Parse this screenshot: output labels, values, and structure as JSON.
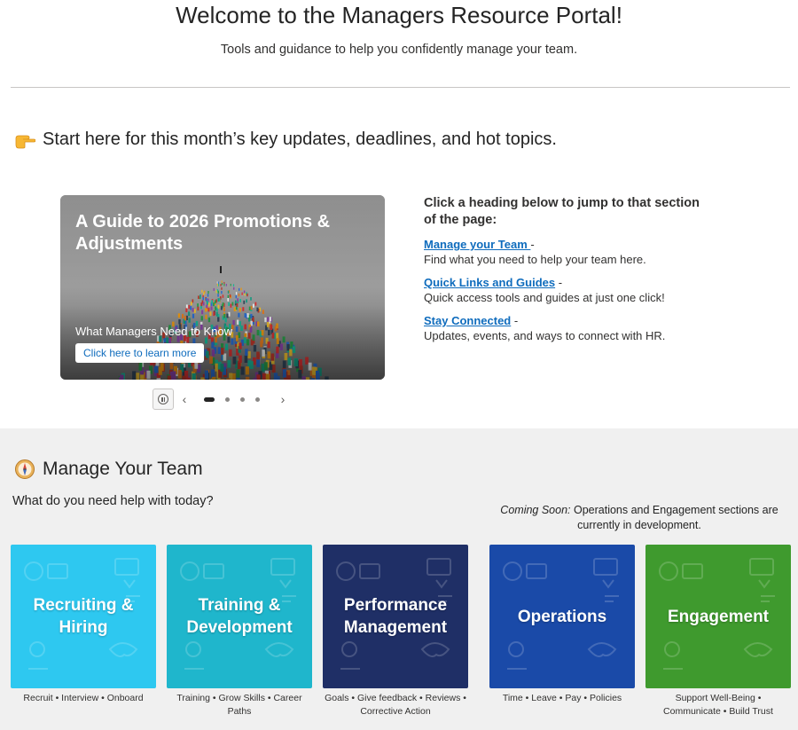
{
  "header": {
    "title": "Welcome to the Managers Resource Portal!",
    "subtitle": "Tools and guidance to help you confidently manage your team."
  },
  "start": {
    "icon": "pointing-hand-icon",
    "text": "Start here for this month’s key updates, deadlines, and hot topics."
  },
  "carousel": {
    "slide_title": "A Guide to 2026 Promotions & Adjustments",
    "slide_subtitle": "What Managers Need to Know",
    "button_label": "Click here to learn more",
    "slide_count": 4,
    "active_slide": 1
  },
  "jump": {
    "intro": "Click a heading below to jump to that section of the page:",
    "items": [
      {
        "link": "Manage your Team ",
        "desc": "Find what you need to help your team here."
      },
      {
        "link": "Quick Links and Guides",
        "desc": "Quick access tools and guides at just one click!"
      },
      {
        "link": "Stay Connected",
        "desc": "Updates, events, and ways to connect with HR."
      }
    ]
  },
  "manage": {
    "icon": "compass-icon",
    "title": "Manage Your Team",
    "question": "What do you need help with today?",
    "coming_soon_label": "Coming Soon:",
    "coming_soon_text": " Operations and Engagement sections are currently in development.",
    "tiles": [
      {
        "label": "Recruiting & Hiring",
        "caption": "Recruit • Interview • Onboard",
        "color": "#2ec8f0"
      },
      {
        "label": "Training & Development",
        "caption": "Training • Grow Skills • Career Paths",
        "color": "#1fb6cc"
      },
      {
        "label": "Performance Management",
        "caption": "Goals • Give feedback • Reviews • Corrective Action",
        "color": "#1f2f66"
      },
      {
        "label": "Operations",
        "caption": "Time • Leave • Pay • Policies",
        "color": "#1a4aa8"
      },
      {
        "label": "Engagement",
        "caption": "Support Well-Being • Communicate • Build Trust",
        "color": "#3f9a2e"
      }
    ]
  }
}
